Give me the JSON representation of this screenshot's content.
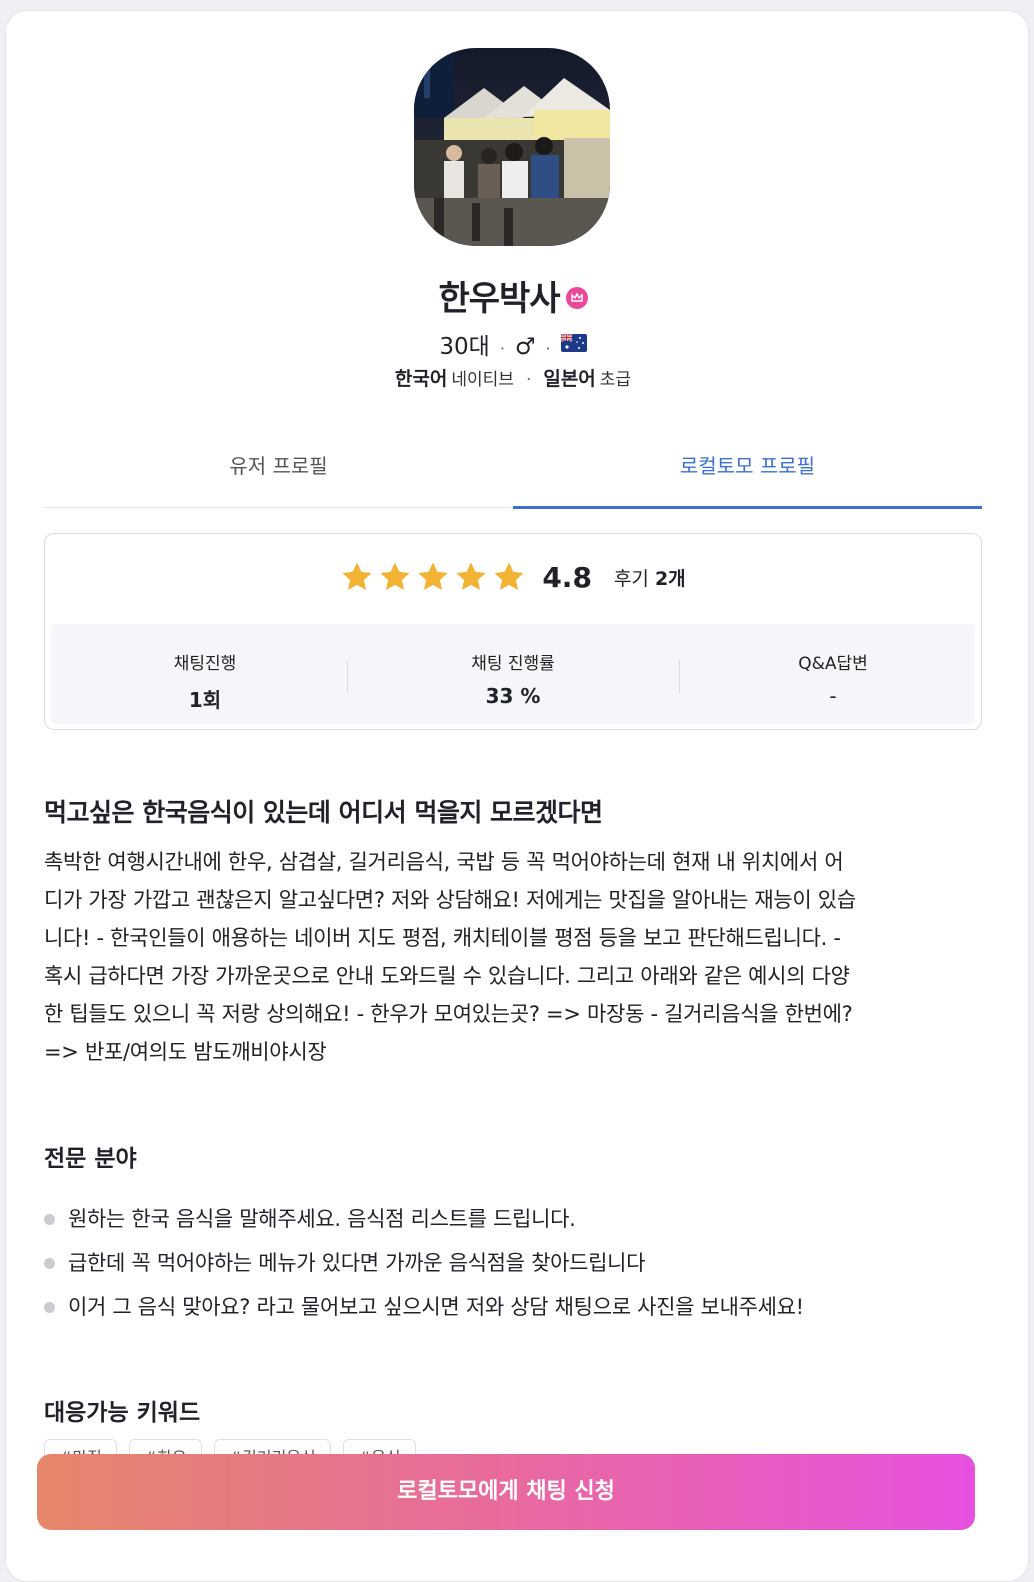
{
  "profile": {
    "name": "한우박사",
    "age": "30대",
    "gender_symbol": "♂",
    "separator": "·",
    "languages": [
      {
        "name": "한국어",
        "level": "네이티브"
      },
      {
        "name": "일본어",
        "level": "초급"
      }
    ]
  },
  "tabs": [
    {
      "label": "유저 프로필",
      "active": false
    },
    {
      "label": "로컬토모 프로필",
      "active": true
    }
  ],
  "stats": {
    "rating": 4.8,
    "rating_text": "4.8",
    "stars_filled": 5,
    "review_label": "후기",
    "review_count": "2개",
    "items": [
      {
        "label": "채팅진행",
        "value": "1회"
      },
      {
        "label": "채팅 진행률",
        "value": "33 %"
      },
      {
        "label": "Q&A답변",
        "value": "-"
      }
    ]
  },
  "intro": {
    "headline": "먹고싶은 한국음식이 있는데 어디서 먹을지 모르겠다면",
    "lines": [
      "촉박한 여행시간내에 한우, 삼겹살, 길거리음식, 국밥 등 꼭 먹어야하는데 현재 내 위치에서 어",
      "디가 가장 가깝고 괜찮은지 알고싶다면? 저와 상담해요! 저에게는 맛집을 알아내는 재능이 있습",
      "니다! - 한국인들이 애용하는 네이버 지도 평점, 캐치테이블 평점 등을 보고 판단해드립니다. -",
      "혹시 급하다면 가장 가까운곳으로 안내 도와드릴 수 있습니다. 그리고 아래와 같은 예시의 다양",
      "한 팁들도 있으니 꼭 저랑 상의해요! - 한우가 모여있는곳? => 마장동 - 길거리음식을 한번에?",
      "=> 반포/여의도 밤도깨비야시장"
    ]
  },
  "expertise": {
    "title": "전문 분야",
    "items": [
      "원하는 한국 음식을 말해주세요. 음식점 리스트를 드립니다.",
      "급한데 꼭 먹어야하는 메뉴가 있다면 가까운 음식점을 찾아드립니다",
      "이거 그 음식 맞아요? 라고 물어보고 싶으시면 저와 상담 채팅으로 사진을 보내주세요!"
    ]
  },
  "keywords": {
    "title": "대응가능 키워드",
    "tags": [
      "#맛집",
      "#한우",
      "#길거리음식",
      "#음식"
    ]
  },
  "cta": {
    "label": "로컬토모에게 채팅 신청"
  },
  "colors": {
    "accent": "#3b6fd1",
    "star": "#f2b233",
    "crown_badge": "#ec4899",
    "cta_start": "#e5876a",
    "cta_end": "#e650df"
  }
}
